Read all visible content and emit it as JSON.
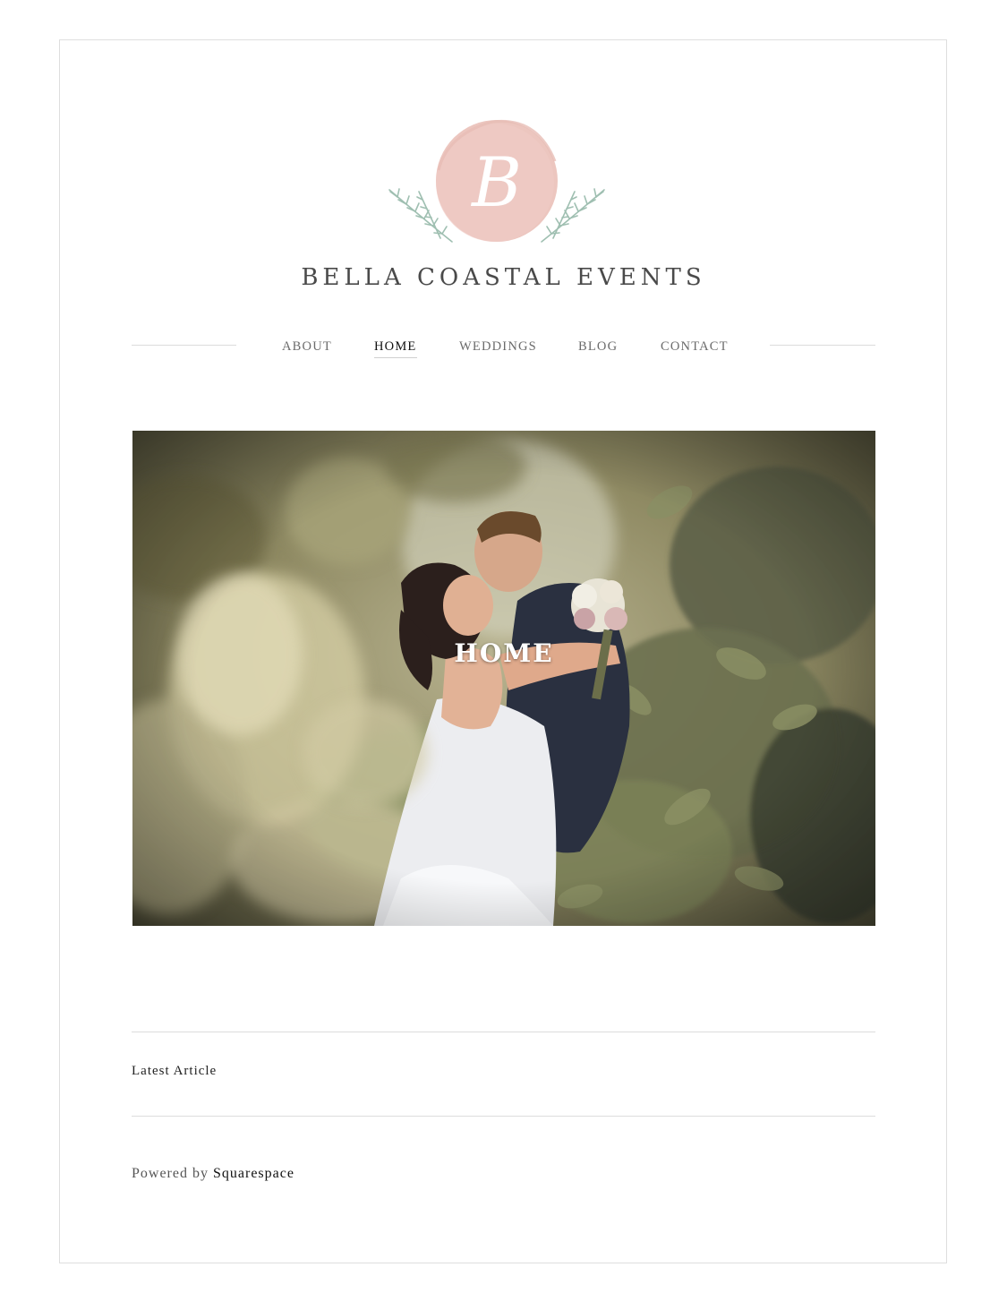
{
  "logo": {
    "letter": "B",
    "circle_color": "#ecc6bf",
    "sprig_color": "#9fbfb1",
    "icon": "monogram-wreath-logo"
  },
  "site": {
    "title": "BELLA COASTAL EVENTS"
  },
  "nav": {
    "items": [
      {
        "label": "ABOUT",
        "active": false
      },
      {
        "label": "HOME",
        "active": true
      },
      {
        "label": "WEDDINGS",
        "active": false
      },
      {
        "label": "BLOG",
        "active": false
      },
      {
        "label": "CONTACT",
        "active": false
      }
    ]
  },
  "hero": {
    "title": "HOME",
    "image": "wedding-couple-kissing-in-foliage-photo"
  },
  "latest": {
    "label": "Latest Article"
  },
  "footer": {
    "powered_prefix": "Powered by",
    "powered_brand": "Squarespace"
  }
}
